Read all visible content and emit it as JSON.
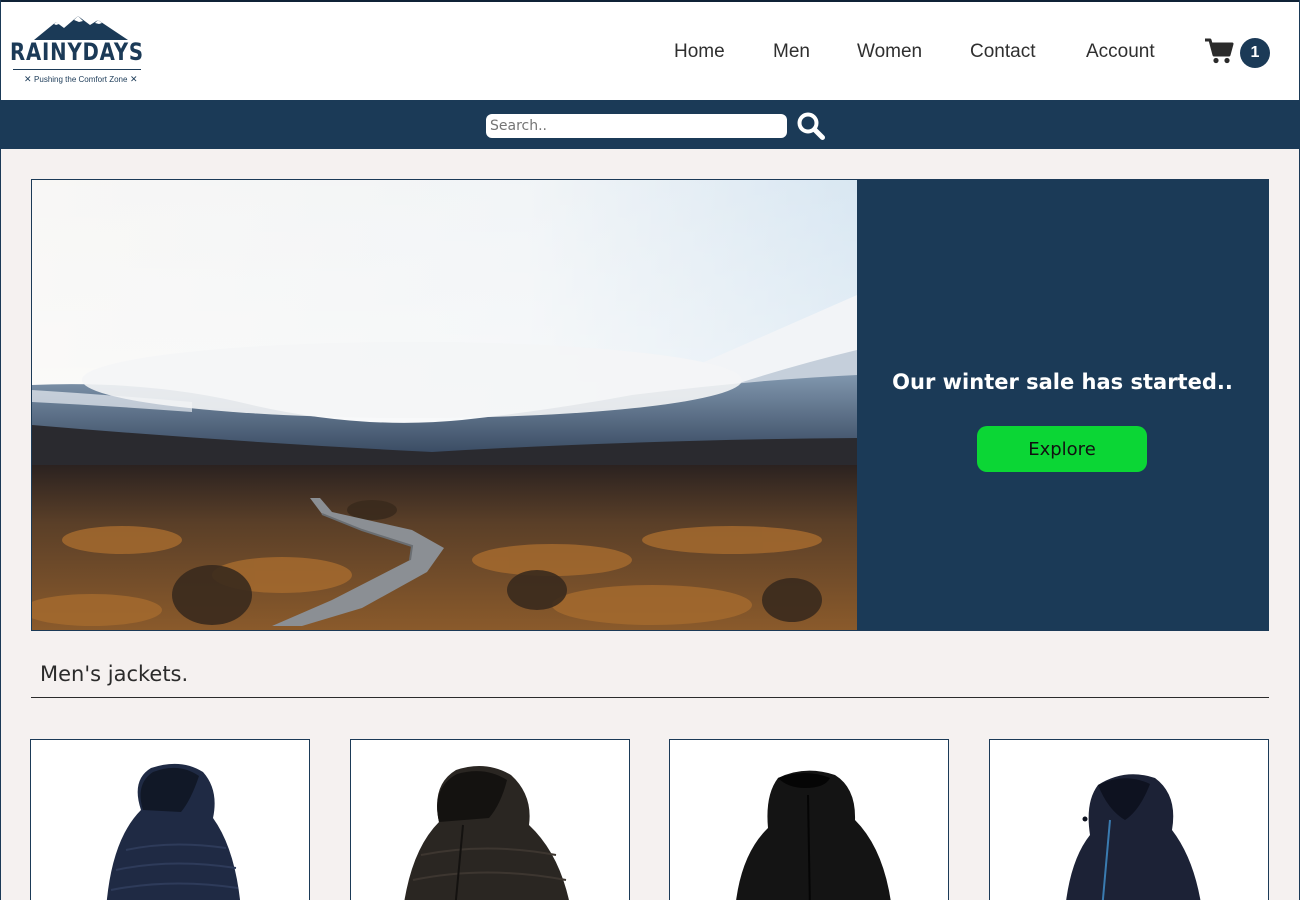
{
  "brand": {
    "name": "RAINYDAYS",
    "tagline": "Pushing the Comfort Zone"
  },
  "nav": {
    "items": [
      {
        "label": "Home",
        "name": "nav-home"
      },
      {
        "label": "Men",
        "name": "nav-men"
      },
      {
        "label": "Women",
        "name": "nav-women"
      },
      {
        "label": "Contact",
        "name": "nav-contact"
      },
      {
        "label": "Account",
        "name": "nav-account"
      }
    ],
    "cart_count": "1",
    "cart_icon": "shopping-cart-icon"
  },
  "search": {
    "placeholder": "Search..",
    "value": "",
    "icon": "magnifier-icon"
  },
  "hero": {
    "image_alt": "landscape-photo",
    "title": "Our winter sale has started..",
    "button_label": "Explore"
  },
  "section": {
    "title": "Men's jackets."
  },
  "products": [
    {
      "color": "#1f2a44"
    },
    {
      "color": "#2a2622"
    },
    {
      "color": "#141414"
    },
    {
      "color": "#1c2236"
    }
  ],
  "colors": {
    "brand_navy": "#1b3a57",
    "accent_green": "#0bd635",
    "page_bg": "#f5f1f0"
  }
}
